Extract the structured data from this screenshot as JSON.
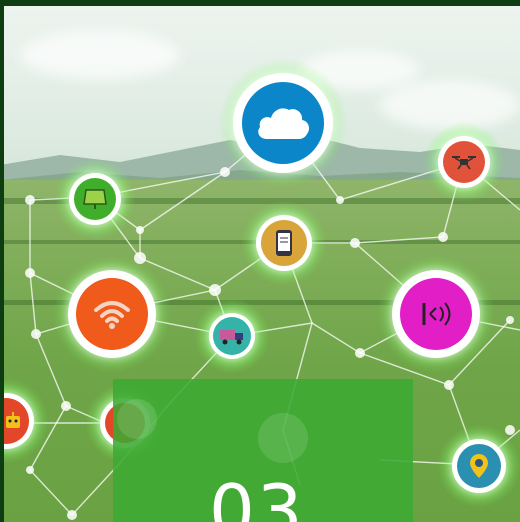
{
  "scene": {
    "description_colors": {
      "overlay_green": "#3caa32",
      "cloud_blue": "#0b86c9",
      "wifi_orange": "#f05a1a",
      "nfc_magenta": "#e21ec7",
      "drone_red": "#e0523a",
      "pin_teal": "#2a8fb0",
      "phone_gold": "#d9a43a",
      "solar_green": "#3fae2a"
    },
    "icons": [
      "cloud-icon",
      "drone-icon",
      "solar-panel-icon",
      "smartphone-icon",
      "wifi-icon",
      "nfc-signal-icon",
      "delivery-truck-icon",
      "robot-icon",
      "location-pin-icon",
      "chart-icon"
    ]
  },
  "overlay": {
    "number": "03"
  }
}
